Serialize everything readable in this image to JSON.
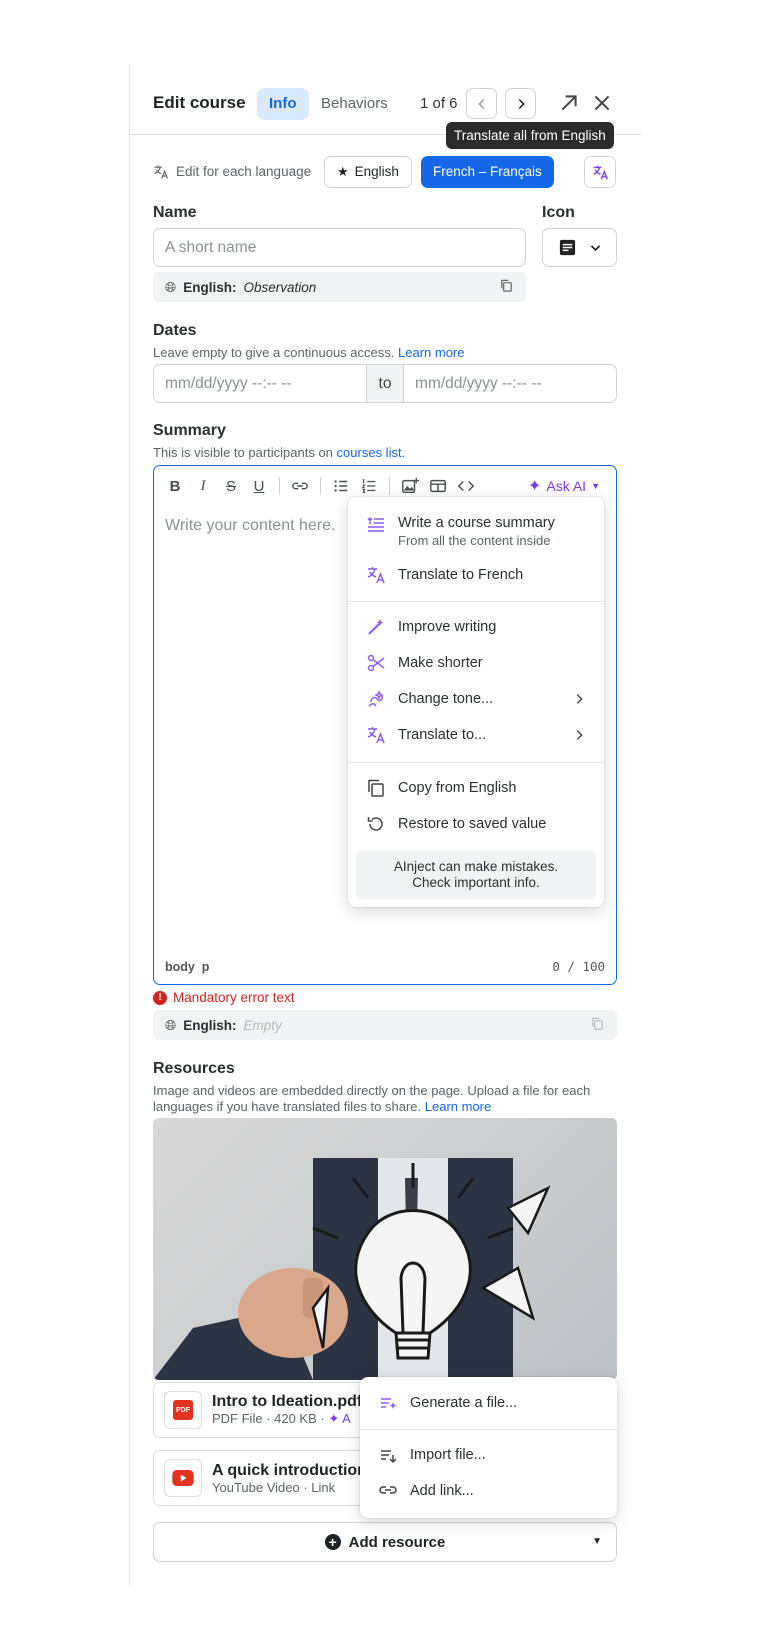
{
  "header": {
    "title": "Edit course",
    "tabs": [
      "Info",
      "Behaviors"
    ],
    "pager": "1 of 6",
    "tooltip": "Translate all from English"
  },
  "language_bar": {
    "label": "Edit for each language",
    "english": "English",
    "french": "French – Français"
  },
  "name": {
    "label": "Name",
    "placeholder": "A short name",
    "translation_prefix": "English:",
    "translation_value": "Observation"
  },
  "icon": {
    "label": "Icon"
  },
  "dates": {
    "label": "Dates",
    "hint": "Leave empty to give a continuous access.",
    "link": "Learn more",
    "start_placeholder": "mm/dd/yyyy --:-- --",
    "sep": "to",
    "end_placeholder": "mm/dd/yyyy --:-- --"
  },
  "summary": {
    "label": "Summary",
    "hint": "This is visible to participants on",
    "link": "courses list",
    "hint_end": ".",
    "ask_ai": "Ask AI",
    "placeholder": "Write your content here.",
    "footer_path": "body  p",
    "count": "0 / 100",
    "error": "Mandatory error text",
    "translation_prefix": "English:",
    "translation_value": "Empty"
  },
  "ai_menu": {
    "items": [
      {
        "label": "Write a course summary",
        "sub": "From all the content inside"
      },
      {
        "label": "Translate to French"
      },
      {
        "label": "Improve writing"
      },
      {
        "label": "Make shorter"
      },
      {
        "label": "Change tone..."
      },
      {
        "label": "Translate to..."
      },
      {
        "label": "Copy from English"
      },
      {
        "label": "Restore to saved value"
      }
    ],
    "disclaimer_line1": "AInject can make mistakes.",
    "disclaimer_line2": "Check important info."
  },
  "resources": {
    "label": "Resources",
    "hint": "Image and videos are embedded directly on the page. Upload a file for each languages if you have translated files to share.",
    "link": "Learn more",
    "items": [
      {
        "title": "Intro to Ideation.pdf",
        "sub": "PDF File · 420 KB ·",
        "badge": "PDF"
      },
      {
        "title": "A quick introduction",
        "sub": "YouTube Video · Link"
      }
    ],
    "add_label": "Add resource",
    "menu": [
      "Generate a file...",
      "Import file...",
      "Add link..."
    ]
  },
  "colors": {
    "accent": "#1468e6",
    "ai": "#7c3aed",
    "error": "#d0271c"
  }
}
